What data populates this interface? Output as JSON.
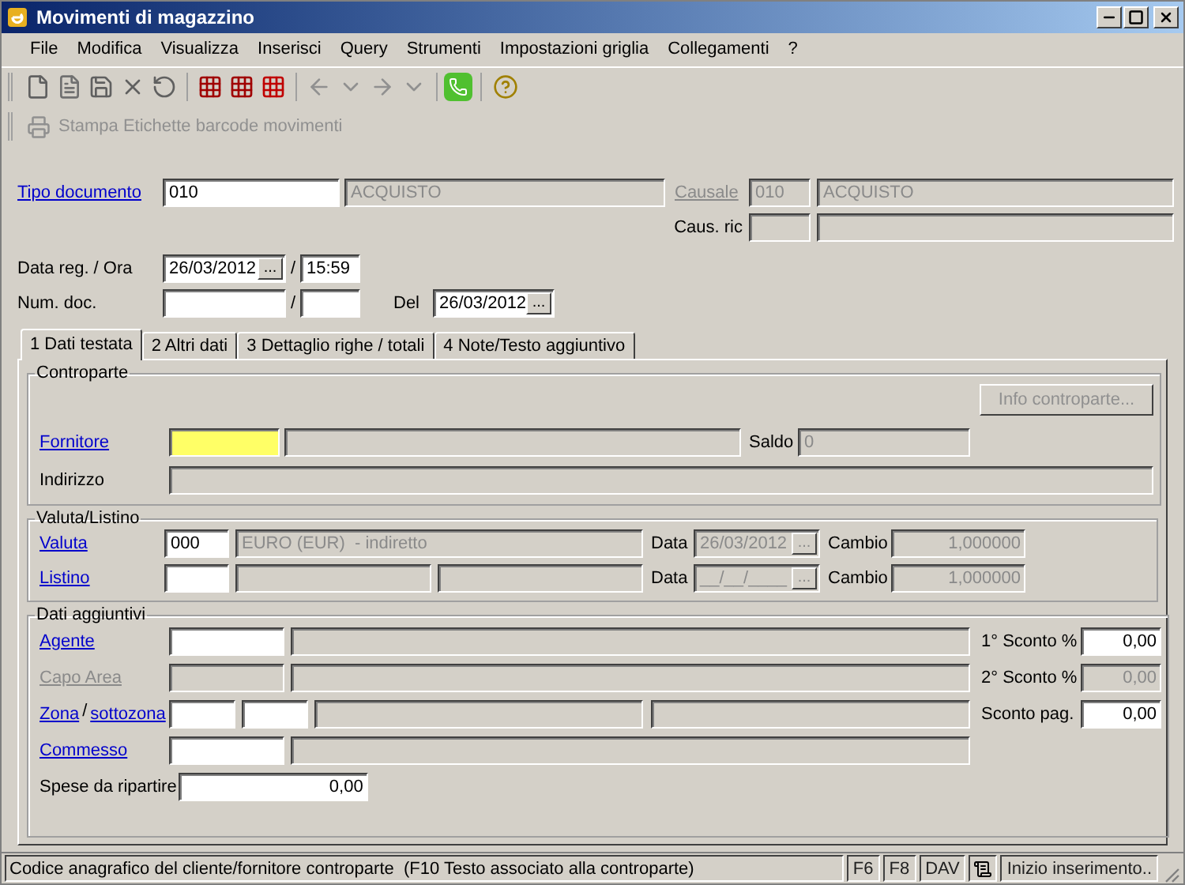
{
  "window": {
    "title": "Movimenti di magazzino"
  },
  "menu": [
    "File",
    "Modifica",
    "Visualizza",
    "Inserisci",
    "Query",
    "Strumenti",
    "Impostazioni griglia",
    "Collegamenti",
    "?"
  ],
  "print_button": {
    "label": "Stampa Etichette barcode movimenti",
    "disabled": true
  },
  "header": {
    "tipo_documento": {
      "label": {
        "text": "Tipo documento",
        "link": true,
        "disabled": false
      },
      "code": {
        "value": "010",
        "disabled": false
      },
      "description": {
        "value": "ACQUISTO",
        "disabled": true
      }
    },
    "causale": {
      "label": {
        "text": "Causale",
        "link": true,
        "disabled": true
      },
      "code": {
        "value": "010",
        "disabled": true
      },
      "description": {
        "value": "ACQUISTO",
        "disabled": true
      }
    },
    "caus_ric": {
      "label": {
        "text": "Caus. ric",
        "link": false,
        "disabled": false
      },
      "code": {
        "disabled": true
      },
      "description": {
        "disabled": true
      }
    },
    "data_reg": {
      "label": {
        "text": "Data reg. / Ora",
        "link": false,
        "disabled": false
      },
      "date": {
        "value": "26/03/2012",
        "button": "...",
        "disabled": false
      },
      "separator": "/",
      "time": {
        "value": "15:59",
        "disabled": false
      }
    },
    "num_doc": {
      "label": {
        "text": "Num. doc.",
        "link": false,
        "disabled": false
      },
      "number": {
        "disabled": false
      },
      "separator": "/",
      "suffix": {
        "disabled": false
      }
    },
    "del": {
      "label": {
        "text": "Del",
        "link": false,
        "disabled": false
      },
      "date": {
        "value": "26/03/2012",
        "button": "...",
        "disabled": false
      }
    }
  },
  "tabs": [
    {
      "label": "1 Dati testata",
      "selected": true
    },
    {
      "label": "2 Altri dati",
      "selected": false
    },
    {
      "label": "3 Dettaglio righe / totali",
      "selected": false
    },
    {
      "label": "4 Note/Testo aggiuntivo",
      "selected": false
    }
  ],
  "controparte": {
    "title": "Controparte",
    "info_button": {
      "label": "Info controparte...",
      "disabled": true
    },
    "fornitore": {
      "label": {
        "text": "Fornitore",
        "link": true,
        "disabled": false
      },
      "code": {
        "disabled": false,
        "focused": true
      },
      "name": {
        "disabled": true
      }
    },
    "saldo": {
      "label": {
        "text": "Saldo",
        "link": false,
        "disabled": false
      },
      "field": {
        "value": "0",
        "disabled": true
      }
    },
    "indirizzo": {
      "label": {
        "text": "Indirizzo",
        "link": false,
        "disabled": false
      },
      "field": {
        "disabled": true
      }
    }
  },
  "valuta_listino": {
    "title": "Valuta/Listino",
    "valuta": {
      "label": {
        "text": "Valuta",
        "link": true,
        "disabled": false
      },
      "code": {
        "value": "000",
        "disabled": false
      },
      "description": {
        "value": "EURO (EUR)  - indiretto",
        "disabled": true
      },
      "date_label": "Data",
      "date": {
        "value": "26/03/2012",
        "button": "...",
        "disabled": true
      },
      "cambio_label": "Cambio",
      "cambio": {
        "value": "1,000000",
        "disabled": true,
        "numeric": true
      }
    },
    "listino": {
      "label": {
        "text": "Listino",
        "link": true,
        "disabled": false
      },
      "code": {
        "disabled": false
      },
      "description_1": {
        "disabled": true
      },
      "description_2": {
        "disabled": true
      },
      "date_label": "Data",
      "date": {
        "value": "__/__/____",
        "button": "...",
        "disabled": true
      },
      "cambio_label": "Cambio",
      "cambio": {
        "value": "1,000000",
        "disabled": true,
        "numeric": true
      }
    }
  },
  "dati_aggiuntivi": {
    "title": "Dati aggiuntivi",
    "agente": {
      "label": {
        "text": "Agente",
        "link": true,
        "disabled": false
      },
      "code": {
        "disabled": false
      },
      "name": {
        "disabled": true
      }
    },
    "capo_area": {
      "label": {
        "text": "Capo Area",
        "link": true,
        "disabled": true
      },
      "code": {
        "disabled": true
      },
      "name": {
        "disabled": true
      }
    },
    "zona": {
      "label": {
        "text": "Zona",
        "link": true,
        "disabled": false
      },
      "separator": "/",
      "sub_label": {
        "text": "sottozona",
        "link": true,
        "disabled": false
      },
      "code": {
        "disabled": false
      },
      "sub_code": {
        "disabled": false
      },
      "name": {
        "disabled": true
      },
      "sub_name": {
        "disabled": true
      }
    },
    "commesso": {
      "label": {
        "text": "Commesso",
        "link": true,
        "disabled": false
      },
      "code": {
        "disabled": false
      },
      "name": {
        "disabled": true
      }
    },
    "spese": {
      "label": {
        "text": "Spese da ripartire",
        "link": false,
        "disabled": false
      },
      "field": {
        "value": "0,00",
        "disabled": false,
        "numeric": true
      }
    },
    "sconti": [
      {
        "label": "1° Sconto %",
        "field": {
          "value": "0,00",
          "disabled": false,
          "numeric": true
        }
      },
      {
        "label": "2° Sconto %",
        "field": {
          "value": "0,00",
          "disabled": true,
          "numeric": true
        }
      },
      {
        "label": "Sconto pag.",
        "field": {
          "value": "0,00",
          "disabled": false,
          "numeric": true
        }
      }
    ]
  },
  "status_bar": {
    "message": "Codice anagrafico del cliente/fornitore controparte  (F10 Testo associato alla controparte)",
    "cells": [
      {
        "kind": "text",
        "text": "F6"
      },
      {
        "kind": "text",
        "text": "F8"
      },
      {
        "kind": "text",
        "text": "DAV"
      },
      {
        "kind": "icon"
      },
      {
        "kind": "text",
        "text": "Inizio inserimento.."
      }
    ]
  }
}
